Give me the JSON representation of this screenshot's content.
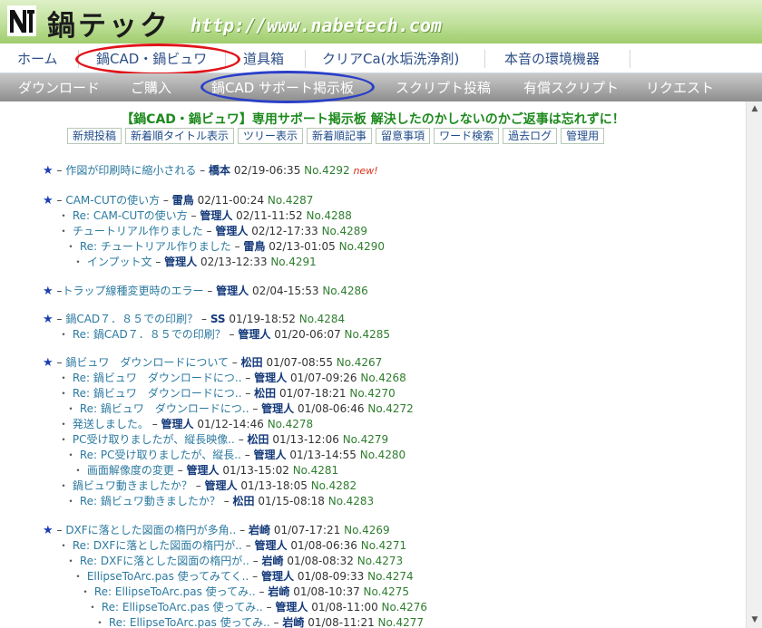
{
  "header": {
    "logo_mark": "NT",
    "logo_text": "鍋テック",
    "url": "http://www.nabetech.com"
  },
  "main_nav": [
    {
      "label": "ホーム"
    },
    {
      "label": "鍋CAD・鍋ビュワ"
    },
    {
      "label": "道具箱"
    },
    {
      "label": "クリアCa(水垢洗浄剤)"
    },
    {
      "label": "本音の環境機器"
    }
  ],
  "sub_nav": [
    {
      "label": "ダウンロード"
    },
    {
      "label": "ご購入"
    },
    {
      "label": "鍋CAD サポート掲示板"
    },
    {
      "label": "スクリプト投稿"
    },
    {
      "label": "有償スクリプト"
    },
    {
      "label": "リクエスト"
    }
  ],
  "board": {
    "title": "【鍋CAD・鍋ビュワ】専用サポート掲示板 解決したのかしないのかご返事は忘れずに！",
    "toolbar": [
      "新規投稿",
      "新着順タイトル表示",
      "ツリー表示",
      "新着順記事",
      "留意事項",
      "ワード検索",
      "過去ログ",
      "管理用"
    ]
  },
  "threads": [
    {
      "subject": "作図が印刷時に縮小される",
      "author": "橋本",
      "date": "02/19-06:35",
      "no": "No.4292",
      "new": "new!"
    },
    {
      "subject": "CAM-CUTの使い方",
      "author": "雷鳥",
      "date": "02/11-00:24",
      "no": "No.4287"
    },
    {
      "subject": "Re: CAM-CUTの使い方",
      "author": "管理人",
      "date": "02/11-11:52",
      "no": "No.4288"
    },
    {
      "subject": "チュートリアル作りました",
      "author": "管理人",
      "date": "02/12-17:33",
      "no": "No.4289"
    },
    {
      "subject": "Re: チュートリアル作りました",
      "author": "雷鳥",
      "date": "02/13-01:05",
      "no": "No.4290"
    },
    {
      "subject": "インプット文",
      "author": "管理人",
      "date": "02/13-12:33",
      "no": "No.4291"
    },
    {
      "subject": "トラップ線種変更時のエラー",
      "author": "管理人",
      "date": "02/04-15:53",
      "no": "No.4286"
    },
    {
      "subject": "鍋CAD７．８５での印刷？",
      "author": "SS",
      "date": "01/19-18:52",
      "no": "No.4284"
    },
    {
      "subject": "Re: 鍋CAD７．８５での印刷？",
      "author": "管理人",
      "date": "01/20-06:07",
      "no": "No.4285"
    },
    {
      "subject": "鍋ビュワ　ダウンロードについて",
      "author": "松田",
      "date": "01/07-08:55",
      "no": "No.4267"
    },
    {
      "subject": "Re: 鍋ビュワ　ダウンロードにつ..",
      "author": "管理人",
      "date": "01/07-09:26",
      "no": "No.4268"
    },
    {
      "subject": "Re: 鍋ビュワ　ダウンロードにつ..",
      "author": "松田",
      "date": "01/07-18:21",
      "no": "No.4270"
    },
    {
      "subject": "Re: 鍋ビュワ　ダウンロードにつ..",
      "author": "管理人",
      "date": "01/08-06:46",
      "no": "No.4272"
    },
    {
      "subject": "発送しました。",
      "author": "管理人",
      "date": "01/12-14:46",
      "no": "No.4278"
    },
    {
      "subject": "PC受け取りましたが、縦長映像..",
      "author": "松田",
      "date": "01/13-12:06",
      "no": "No.4279"
    },
    {
      "subject": "Re: PC受け取りましたが、縦長..",
      "author": "管理人",
      "date": "01/13-14:55",
      "no": "No.4280"
    },
    {
      "subject": "画面解像度の変更",
      "author": "管理人",
      "date": "01/13-15:02",
      "no": "No.4281"
    },
    {
      "subject": "鍋ビュワ動きましたか？",
      "author": "管理人",
      "date": "01/13-18:05",
      "no": "No.4282"
    },
    {
      "subject": "Re: 鍋ビュワ動きましたか？",
      "author": "松田",
      "date": "01/15-08:18",
      "no": "No.4283"
    },
    {
      "subject": "DXFに落とした図面の楕円が多角..",
      "author": "岩崎",
      "date": "01/07-17:21",
      "no": "No.4269"
    },
    {
      "subject": "Re: DXFに落とした図面の楕円が..",
      "author": "管理人",
      "date": "01/08-06:36",
      "no": "No.4271"
    },
    {
      "subject": "Re: DXFに落とした図面の楕円が..",
      "author": "岩崎",
      "date": "01/08-08:32",
      "no": "No.4273"
    },
    {
      "subject": "EllipseToArc.pas 使ってみてく..",
      "author": "管理人",
      "date": "01/08-09:33",
      "no": "No.4274"
    },
    {
      "subject": "Re: EllipseToArc.pas 使ってみ..",
      "author": "岩崎",
      "date": "01/08-10:37",
      "no": "No.4275"
    },
    {
      "subject": "Re: EllipseToArc.pas 使ってみ..",
      "author": "管理人",
      "date": "01/08-11:00",
      "no": "No.4276"
    },
    {
      "subject": "Re: EllipseToArc.pas 使ってみ..",
      "author": "岩崎",
      "date": "01/08-11:21",
      "no": "No.4277"
    }
  ],
  "colors": {
    "header_green": "#9fcd6c",
    "nav_text": "#2d4f86",
    "title_green": "#1d8a1d",
    "red_circle": "#e0141a",
    "blue_circle": "#2b3fc8"
  }
}
